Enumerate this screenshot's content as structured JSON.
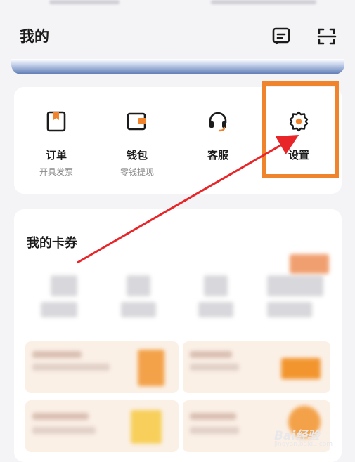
{
  "header": {
    "title": "我的",
    "message_icon": "message-square-icon",
    "scan_icon": "scan-icon"
  },
  "services": [
    {
      "label": "订单",
      "sub": "开具发票",
      "icon": "order-bookmark-icon"
    },
    {
      "label": "钱包",
      "sub": "零钱提现",
      "icon": "wallet-icon"
    },
    {
      "label": "客服",
      "sub": "",
      "icon": "headset-icon"
    },
    {
      "label": "设置",
      "sub": "",
      "icon": "gear-icon"
    }
  ],
  "coupons": {
    "title": "我的卡券"
  },
  "watermark": {
    "text": "Bai经验",
    "url": "jingyan.baidu.com"
  },
  "colors": {
    "accent_orange": "#f0842c",
    "arrow_red": "#e8262a",
    "banner_blue": "#5b79b3"
  }
}
